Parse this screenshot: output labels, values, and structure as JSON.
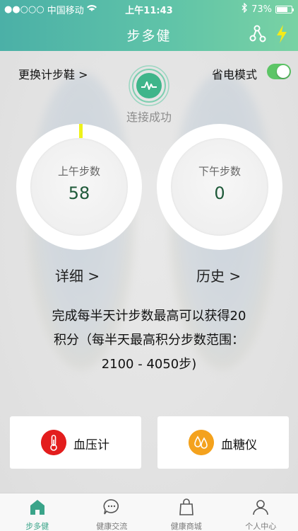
{
  "status_bar": {
    "carrier": "中国移动",
    "time": "上午11:43",
    "battery": "73%",
    "battery_level": 0.73
  },
  "nav": {
    "title": "步多健"
  },
  "controls": {
    "change_shoe": "更换计步鞋 >",
    "power_save_label": "省电模式",
    "power_save_on": true
  },
  "connection": {
    "status": "连接成功"
  },
  "steps": {
    "am_label": "上午步数",
    "am_value": "58",
    "pm_label": "下午步数",
    "pm_value": "0"
  },
  "links": {
    "detail": "详细 >",
    "history": "历史 >"
  },
  "info_text_line1": "完成每半天计步数最高可以获得20",
  "info_text_line2": "积分（每半天最高积分步数范围：",
  "info_text_line3": "2100 - 4050步)",
  "tiles": {
    "blood_pressure": "血压计",
    "blood_glucose": "血糖仪"
  },
  "tabs": [
    {
      "label": "步多健",
      "icon": "home-icon",
      "active": true
    },
    {
      "label": "健康交流",
      "icon": "chat-icon",
      "active": false
    },
    {
      "label": "健康商城",
      "icon": "shopping-bag-icon",
      "active": false
    },
    {
      "label": "个人中心",
      "icon": "person-icon",
      "active": false
    }
  ],
  "colors": {
    "accent": "#5cc0a6",
    "text_value": "#1f5a3a",
    "toggle_on": "#5cc566",
    "bp_icon": "#e31d1d",
    "bg_icon": "#f4a21d",
    "ring_marker": "#eef21a"
  }
}
